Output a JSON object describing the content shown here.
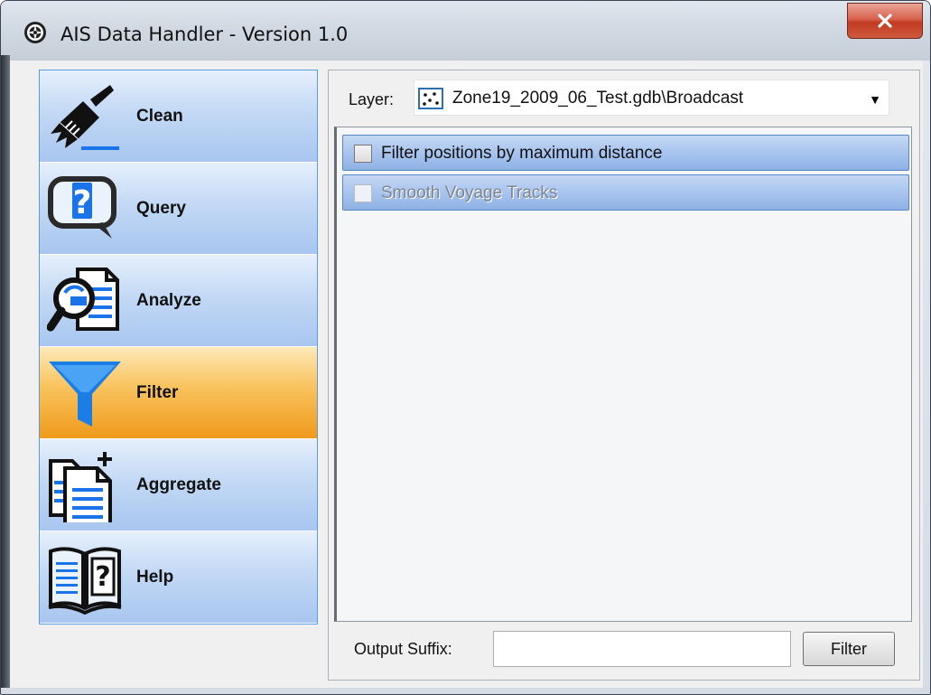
{
  "window": {
    "title": "AIS Data Handler - Version 1.0",
    "close_glyph": "x"
  },
  "nav": {
    "items": [
      {
        "label": "Clean",
        "icon": "broom-icon",
        "active": false
      },
      {
        "label": "Query",
        "icon": "question-bubble-icon",
        "active": false
      },
      {
        "label": "Analyze",
        "icon": "magnifier-document-icon",
        "active": false
      },
      {
        "label": "Filter",
        "icon": "funnel-icon",
        "active": true
      },
      {
        "label": "Aggregate",
        "icon": "add-documents-icon",
        "active": false
      },
      {
        "label": "Help",
        "icon": "help-book-icon",
        "active": false
      }
    ]
  },
  "layer": {
    "label": "Layer:",
    "value": "Zone19_2009_06_Test.gdb\\Broadcast",
    "icon": "point-layer-icon"
  },
  "filters": [
    {
      "label": "Filter positions by maximum distance",
      "checked": false,
      "enabled": true
    },
    {
      "label": "Smooth Voyage Tracks",
      "checked": false,
      "enabled": false
    }
  ],
  "output": {
    "suffix_label": "Output Suffix:",
    "suffix_value": "",
    "button_label": "Filter"
  },
  "colors": {
    "nav_active": "#f5a623",
    "nav_inactive": "#b7d0f2",
    "filter_row": "#a8c4ee",
    "close_button": "#c8452e"
  }
}
